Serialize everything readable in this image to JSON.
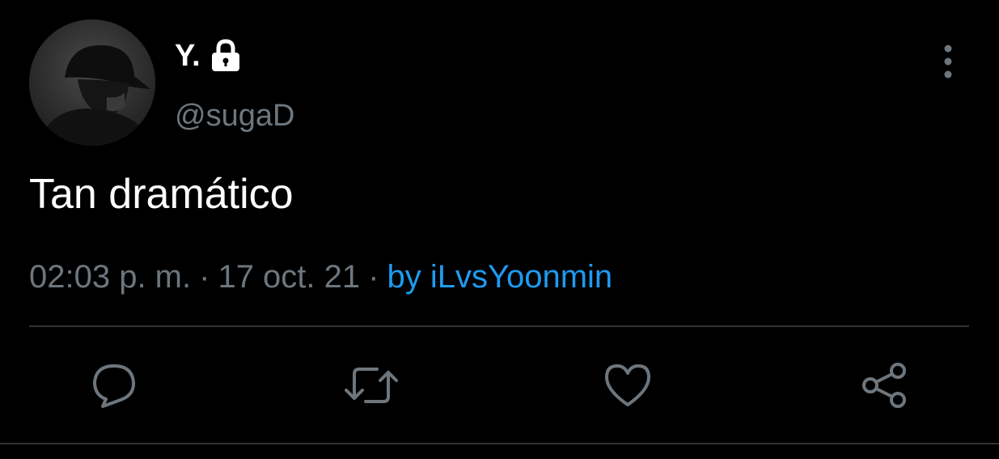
{
  "tweet": {
    "author": {
      "display_name": "Y.",
      "handle": "@sugaD",
      "protected_icon": "lock-icon",
      "avatar_icon": "profile-photo"
    },
    "text": "Tan dramático",
    "timestamp": "02:03 p. m.",
    "date": "17 oct. 21",
    "separator": "·",
    "source": "by iLvsYoonmin",
    "more_icon": "more-vertical-icon"
  },
  "actions": [
    {
      "name": "reply",
      "icon": "reply-icon"
    },
    {
      "name": "retweet",
      "icon": "retweet-icon"
    },
    {
      "name": "like",
      "icon": "heart-icon"
    },
    {
      "name": "share",
      "icon": "share-icon"
    }
  ],
  "colors": {
    "background": "#000000",
    "text_primary": "#ffffff",
    "text_secondary": "#6e767d",
    "link": "#1d9bf0",
    "divider": "#2f3336"
  }
}
